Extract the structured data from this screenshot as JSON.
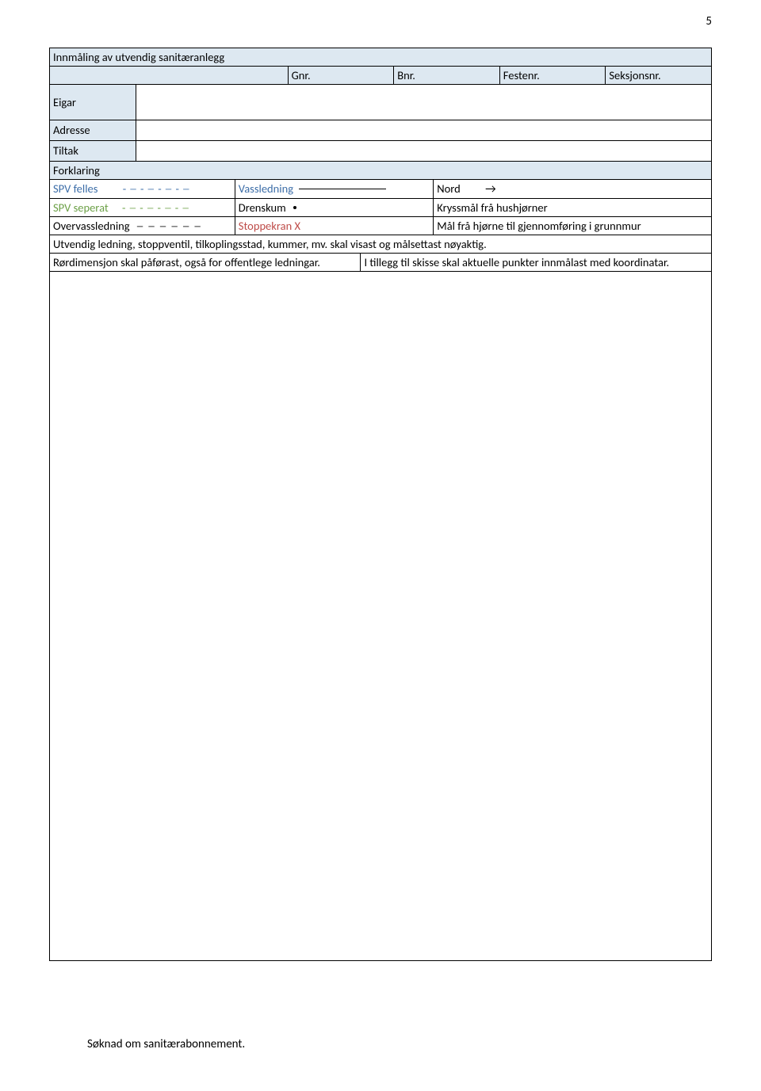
{
  "page_number": "5",
  "title": "Innmåling av utvendig sanitæranlegg",
  "header_row": {
    "gnr": "Gnr.",
    "bnr": "Bnr.",
    "festenr": "Festenr.",
    "seksjonsnr": "Seksjonsnr."
  },
  "labels": {
    "eigar": "Eigar",
    "adresse": "Adresse",
    "tiltak": "Tiltak",
    "forklaring": "Forklaring"
  },
  "legend": {
    "row1": {
      "label": "SPV felles",
      "pattern": "- ─ - ─ - ─ - ─",
      "mid": "Vassledning",
      "right_label": "Nord",
      "right_symbol": "→"
    },
    "row2": {
      "label": "SPV seperat",
      "pattern": "- ─ - ─ - ─ - ─",
      "mid": "Drenskum",
      "right": "Kryssmål frå hushjørner"
    },
    "row3": {
      "label": "Overvassledning",
      "pattern": "─  ─  ─  ─  ─  ─",
      "mid": "Stoppekran    X",
      "right": "Mål frå hjørne til gjennomføring i grunnmur"
    }
  },
  "notes": {
    "line1": "Utvendig ledning, stoppventil, tilkoplingsstad, kummer, mv. skal visast og målsettast nøyaktig.",
    "line2_left": "Rørdimensjon skal påførast, også for offentlege ledningar.",
    "line2_right": "I tillegg til skisse skal aktuelle punkter innmålast med koordinatar."
  },
  "footer": "Søknad om sanitærabonnement."
}
